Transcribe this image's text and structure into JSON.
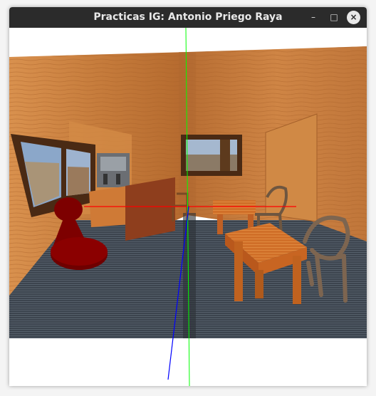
{
  "window": {
    "title": "Practicas IG: Antonio Priego Raya",
    "minimize_label": "–",
    "maximize_label": "□",
    "close_label": "×"
  },
  "scene": {
    "axis_colors": {
      "x": "#ff0000",
      "y": "#00ff00",
      "z": "#0000ff"
    },
    "colors": {
      "wood": "#c77d3d",
      "floor": "#3d4550",
      "red_piece": "#8b0000",
      "furniture": "#d4722a",
      "chair": "#7a6048"
    }
  }
}
